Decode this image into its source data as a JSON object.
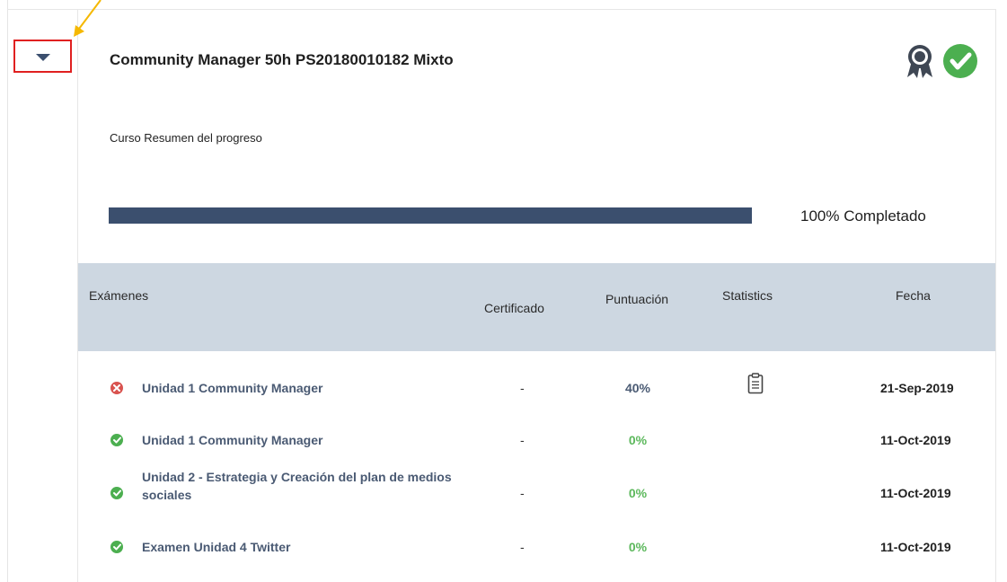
{
  "course": {
    "title": "Community Manager 50h PS20180010182 Mixto",
    "summary_label": "Curso Resumen del progreso",
    "progress": 100,
    "progress_text": "100% Completado"
  },
  "icons": {
    "toggle": "caret-down-icon",
    "badge": "award-ribbon-icon",
    "completed": "check-circle-icon",
    "fail": "x-circle-icon",
    "pass": "check-circle-icon",
    "stats": "clipboard-icon"
  },
  "colors": {
    "accent": "#3b4f6e",
    "header_bg": "#cdd7e1",
    "pass": "#4caf50",
    "fail": "#d9534f",
    "annotation_box": "#e02020",
    "annotation_arrow": "#f5b800"
  },
  "table": {
    "headers": {
      "exams": "Exámenes",
      "certificate": "Certificado",
      "score": "Puntuación",
      "statistics": "Statistics",
      "date": "Fecha"
    },
    "rows": [
      {
        "status": "fail",
        "name": "Unidad 1 Community Manager",
        "certificate": "-",
        "score": "40%",
        "has_stats": true,
        "date": "21-Sep-2019"
      },
      {
        "status": "pass",
        "name": "Unidad 1 Community Manager",
        "certificate": "-",
        "score": "0%",
        "has_stats": false,
        "date": "11-Oct-2019"
      },
      {
        "status": "pass",
        "name": "Unidad 2 - Estrategia y Creación del plan de medios sociales",
        "certificate": "-",
        "score": "0%",
        "has_stats": false,
        "date": "11-Oct-2019"
      },
      {
        "status": "pass",
        "name": "Examen Unidad 4 Twitter",
        "certificate": "-",
        "score": "0%",
        "has_stats": false,
        "date": "11-Oct-2019"
      }
    ]
  }
}
